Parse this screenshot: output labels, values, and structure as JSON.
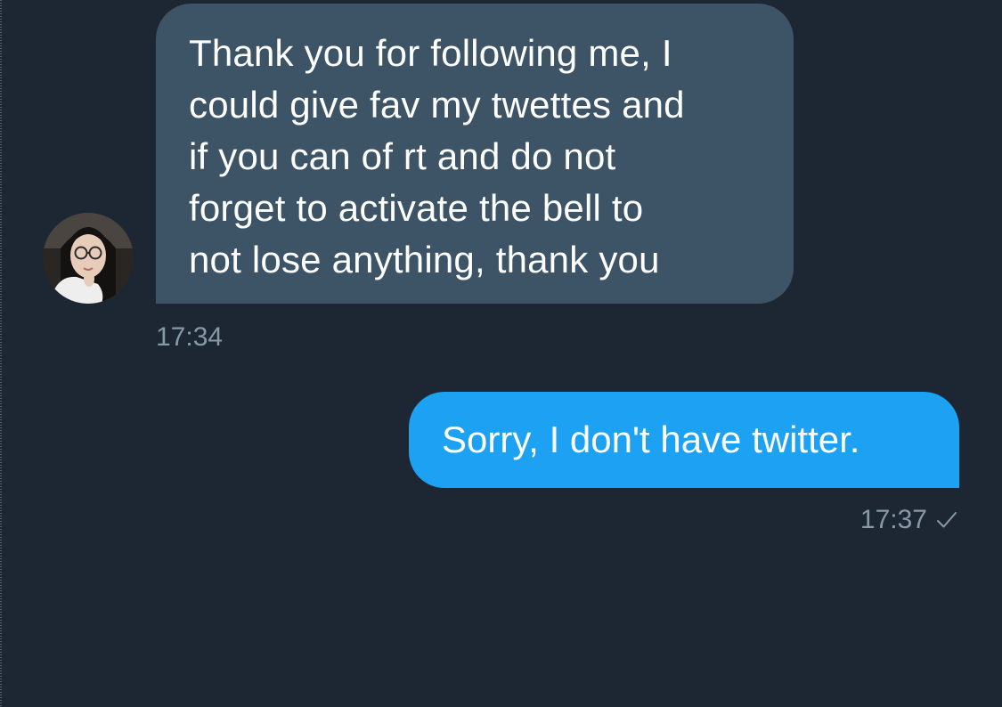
{
  "conversation": {
    "messages": [
      {
        "direction": "incoming",
        "avatar": "user-photo-avatar",
        "text": "Thank you for following me, I\ncould give fav my twettes and\nif you can of rt and do not\nforget to activate the bell to\nnot lose anything, thank you",
        "time": "17:34"
      },
      {
        "direction": "outgoing",
        "text": "Sorry, I don't have twitter.",
        "time": "17:37",
        "status_icon": "checkmark-icon"
      }
    ]
  },
  "colors": {
    "background": "#1c2733",
    "incoming_bubble": "#3d5466",
    "outgoing_bubble": "#1da1f2",
    "timestamp": "#8899a6",
    "text": "#ffffff"
  }
}
